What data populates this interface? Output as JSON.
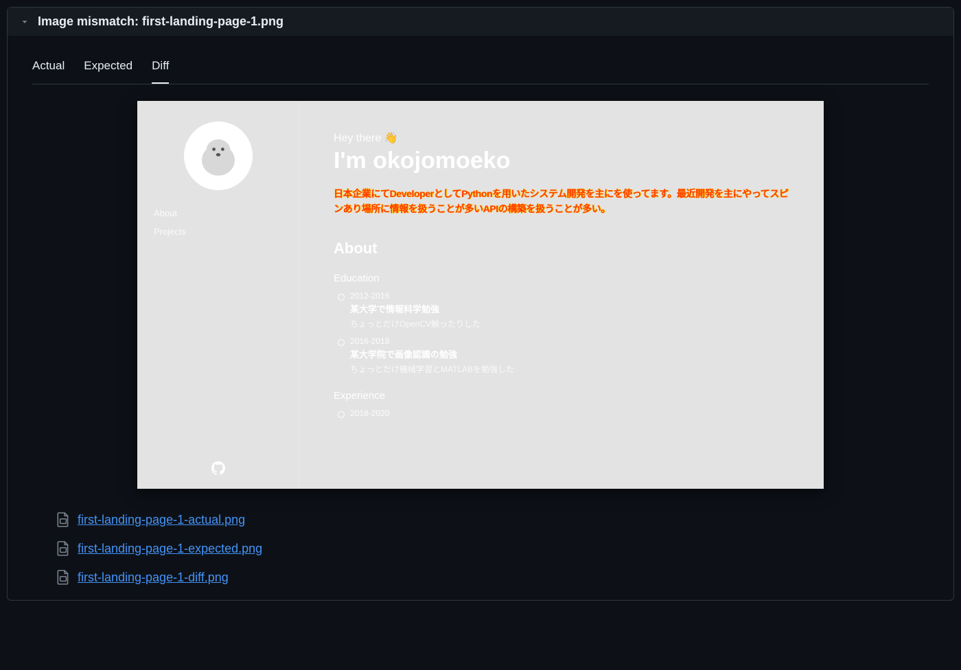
{
  "header": {
    "title": "Image mismatch: first-landing-page-1.png"
  },
  "tabs": {
    "actual": "Actual",
    "expected": "Expected",
    "diff": "Diff"
  },
  "diff_content": {
    "sidebar": {
      "nav_about": "About",
      "nav_projects": "Projects"
    },
    "hey": "Hey there 👋",
    "im": "I'm okojomoeko",
    "diff_paragraph": "日本企業にてDeveloperとしてPythonを用いたシステム開発を主にを使ってます。最近開発を主にやってスピンあり場所に情報を扱うことが多いAPIの構築を扱うことが多い。",
    "about_heading": "About",
    "education_heading": "Education",
    "education": [
      {
        "years": "2012-2016",
        "title": "某大学で情報科学勉強",
        "desc": "ちょっとだけOpenCV触ったりした"
      },
      {
        "years": "2016-2018",
        "title": "某大学院で画像認識の勉強",
        "desc": "ちょっとだけ機械学習とMATLABを勉強した"
      }
    ],
    "experience_heading": "Experience",
    "experience": [
      {
        "years": "2018-2020"
      }
    ]
  },
  "attachments": {
    "actual": "first-landing-page-1-actual.png",
    "expected": "first-landing-page-1-expected.png",
    "diff": "first-landing-page-1-diff.png"
  }
}
